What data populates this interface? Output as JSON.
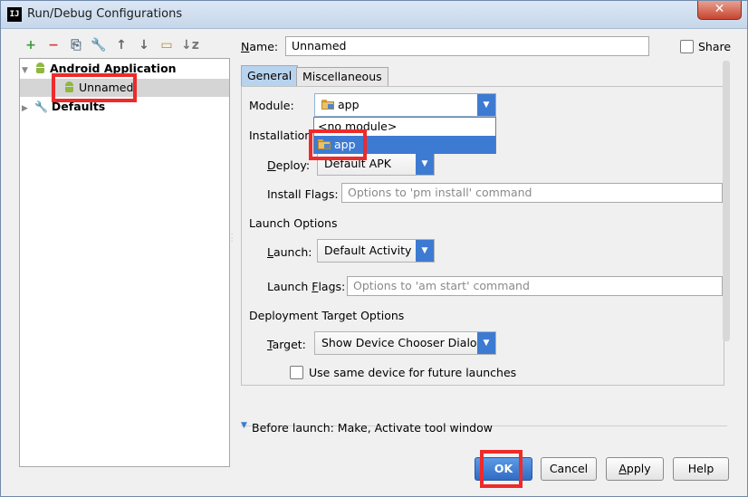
{
  "window": {
    "title": "Run/Debug Configurations",
    "logo_text": "IJ",
    "close_glyph": "✕"
  },
  "toolbar": {
    "icons": [
      {
        "name": "add-icon",
        "glyph": "+",
        "color": "#3a9a3a"
      },
      {
        "name": "remove-icon",
        "glyph": "−",
        "color": "#d23c3c"
      },
      {
        "name": "copy-icon",
        "glyph": "⎘",
        "color": "#5a6f86"
      },
      {
        "name": "wrench-icon",
        "glyph": "🔧",
        "color": "#5a6f86"
      },
      {
        "name": "move-up-icon",
        "glyph": "↑",
        "color": "#666666"
      },
      {
        "name": "move-down-icon",
        "glyph": "↓",
        "color": "#666666"
      },
      {
        "name": "folder-icon",
        "glyph": "▭",
        "color": "#b7892e"
      },
      {
        "name": "sort-icon",
        "glyph": "↓z",
        "color": "#777777"
      }
    ]
  },
  "tree": {
    "android_application": "Android Application",
    "unnamed": "Unnamed",
    "defaults": "Defaults"
  },
  "form": {
    "name_label_pre": "N",
    "name_label_post": "ame:",
    "name_value": "Unnamed",
    "share_label": "Share",
    "tabs": {
      "general": "General",
      "misc": "Miscellaneous"
    },
    "module_label": "Module:",
    "module_value": "app",
    "module_options": [
      "<no module>",
      "app"
    ],
    "installation_label": "Installation O",
    "deploy_label_pre": "D",
    "deploy_label_post": "eploy:",
    "deploy_value": "Default APK",
    "install_flags_label": "Install Flags:",
    "install_flags_placeholder": "Options to 'pm install' command",
    "launch_options_label": "Launch Options",
    "launch_label_pre": "L",
    "launch_label_post": "aunch:",
    "launch_value": "Default Activity",
    "launch_flags_label_pre": "Launch ",
    "launch_flags_label_u": "F",
    "launch_flags_label_post": "lags:",
    "launch_flags_placeholder": "Options to 'am start' command",
    "deployment_target_label": "Deployment Target Options",
    "target_label_pre": "T",
    "target_label_post": "arget:",
    "target_value": "Show Device Chooser Dialog",
    "same_device_label": "Use same device for future launches",
    "before_launch_label": "Before launch: Make, Activate tool window"
  },
  "buttons": {
    "ok": "OK",
    "cancel": "Cancel",
    "apply_u": "A",
    "apply_rest": "pply",
    "help": "Help"
  },
  "colors": {
    "accent": "#3d7bd2",
    "highlight": "#ee2a2a",
    "android_green": "#8fb83f"
  }
}
